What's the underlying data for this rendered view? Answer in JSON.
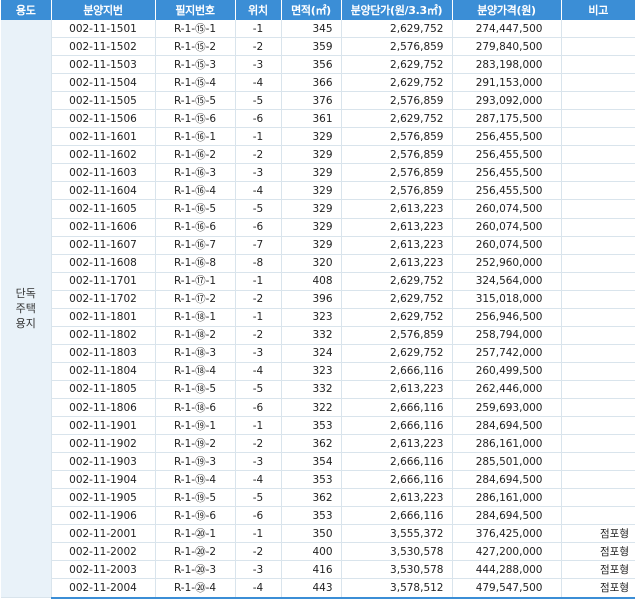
{
  "headers": [
    "용도",
    "분양지번",
    "필지번호",
    "위치",
    "면적(㎡)",
    "분양단가(원/3.3㎡)",
    "분양가격(원)",
    "비고"
  ],
  "usage_lines": [
    "단독",
    "주택",
    "용지"
  ],
  "rows": [
    {
      "lot": "002-11-1501",
      "parcel": "R-1-⑮-1",
      "pos": "-1",
      "area": "345",
      "unit": "2,629,752",
      "price": "274,447,500",
      "note": ""
    },
    {
      "lot": "002-11-1502",
      "parcel": "R-1-⑮-2",
      "pos": "-2",
      "area": "359",
      "unit": "2,576,859",
      "price": "279,840,500",
      "note": ""
    },
    {
      "lot": "002-11-1503",
      "parcel": "R-1-⑮-3",
      "pos": "-3",
      "area": "356",
      "unit": "2,629,752",
      "price": "283,198,000",
      "note": ""
    },
    {
      "lot": "002-11-1504",
      "parcel": "R-1-⑮-4",
      "pos": "-4",
      "area": "366",
      "unit": "2,629,752",
      "price": "291,153,000",
      "note": ""
    },
    {
      "lot": "002-11-1505",
      "parcel": "R-1-⑮-5",
      "pos": "-5",
      "area": "376",
      "unit": "2,576,859",
      "price": "293,092,000",
      "note": ""
    },
    {
      "lot": "002-11-1506",
      "parcel": "R-1-⑮-6",
      "pos": "-6",
      "area": "361",
      "unit": "2,629,752",
      "price": "287,175,500",
      "note": ""
    },
    {
      "lot": "002-11-1601",
      "parcel": "R-1-⑯-1",
      "pos": "-1",
      "area": "329",
      "unit": "2,576,859",
      "price": "256,455,500",
      "note": ""
    },
    {
      "lot": "002-11-1602",
      "parcel": "R-1-⑯-2",
      "pos": "-2",
      "area": "329",
      "unit": "2,576,859",
      "price": "256,455,500",
      "note": ""
    },
    {
      "lot": "002-11-1603",
      "parcel": "R-1-⑯-3",
      "pos": "-3",
      "area": "329",
      "unit": "2,576,859",
      "price": "256,455,500",
      "note": ""
    },
    {
      "lot": "002-11-1604",
      "parcel": "R-1-⑯-4",
      "pos": "-4",
      "area": "329",
      "unit": "2,576,859",
      "price": "256,455,500",
      "note": ""
    },
    {
      "lot": "002-11-1605",
      "parcel": "R-1-⑯-5",
      "pos": "-5",
      "area": "329",
      "unit": "2,613,223",
      "price": "260,074,500",
      "note": ""
    },
    {
      "lot": "002-11-1606",
      "parcel": "R-1-⑯-6",
      "pos": "-6",
      "area": "329",
      "unit": "2,613,223",
      "price": "260,074,500",
      "note": ""
    },
    {
      "lot": "002-11-1607",
      "parcel": "R-1-⑯-7",
      "pos": "-7",
      "area": "329",
      "unit": "2,613,223",
      "price": "260,074,500",
      "note": ""
    },
    {
      "lot": "002-11-1608",
      "parcel": "R-1-⑯-8",
      "pos": "-8",
      "area": "320",
      "unit": "2,613,223",
      "price": "252,960,000",
      "note": ""
    },
    {
      "lot": "002-11-1701",
      "parcel": "R-1-⑰-1",
      "pos": "-1",
      "area": "408",
      "unit": "2,629,752",
      "price": "324,564,000",
      "note": ""
    },
    {
      "lot": "002-11-1702",
      "parcel": "R-1-⑰-2",
      "pos": "-2",
      "area": "396",
      "unit": "2,629,752",
      "price": "315,018,000",
      "note": ""
    },
    {
      "lot": "002-11-1801",
      "parcel": "R-1-⑱-1",
      "pos": "-1",
      "area": "323",
      "unit": "2,629,752",
      "price": "256,946,500",
      "note": ""
    },
    {
      "lot": "002-11-1802",
      "parcel": "R-1-⑱-2",
      "pos": "-2",
      "area": "332",
      "unit": "2,576,859",
      "price": "258,794,000",
      "note": ""
    },
    {
      "lot": "002-11-1803",
      "parcel": "R-1-⑱-3",
      "pos": "-3",
      "area": "324",
      "unit": "2,629,752",
      "price": "257,742,000",
      "note": ""
    },
    {
      "lot": "002-11-1804",
      "parcel": "R-1-⑱-4",
      "pos": "-4",
      "area": "323",
      "unit": "2,666,116",
      "price": "260,499,500",
      "note": ""
    },
    {
      "lot": "002-11-1805",
      "parcel": "R-1-⑱-5",
      "pos": "-5",
      "area": "332",
      "unit": "2,613,223",
      "price": "262,446,000",
      "note": ""
    },
    {
      "lot": "002-11-1806",
      "parcel": "R-1-⑱-6",
      "pos": "-6",
      "area": "322",
      "unit": "2,666,116",
      "price": "259,693,000",
      "note": ""
    },
    {
      "lot": "002-11-1901",
      "parcel": "R-1-⑲-1",
      "pos": "-1",
      "area": "353",
      "unit": "2,666,116",
      "price": "284,694,500",
      "note": ""
    },
    {
      "lot": "002-11-1902",
      "parcel": "R-1-⑲-2",
      "pos": "-2",
      "area": "362",
      "unit": "2,613,223",
      "price": "286,161,000",
      "note": ""
    },
    {
      "lot": "002-11-1903",
      "parcel": "R-1-⑲-3",
      "pos": "-3",
      "area": "354",
      "unit": "2,666,116",
      "price": "285,501,000",
      "note": ""
    },
    {
      "lot": "002-11-1904",
      "parcel": "R-1-⑲-4",
      "pos": "-4",
      "area": "353",
      "unit": "2,666,116",
      "price": "284,694,500",
      "note": ""
    },
    {
      "lot": "002-11-1905",
      "parcel": "R-1-⑲-5",
      "pos": "-5",
      "area": "362",
      "unit": "2,613,223",
      "price": "286,161,000",
      "note": ""
    },
    {
      "lot": "002-11-1906",
      "parcel": "R-1-⑲-6",
      "pos": "-6",
      "area": "353",
      "unit": "2,666,116",
      "price": "284,694,500",
      "note": ""
    },
    {
      "lot": "002-11-2001",
      "parcel": "R-1-⑳-1",
      "pos": "-1",
      "area": "350",
      "unit": "3,555,372",
      "price": "376,425,000",
      "note": "점포형"
    },
    {
      "lot": "002-11-2002",
      "parcel": "R-1-⑳-2",
      "pos": "-2",
      "area": "400",
      "unit": "3,530,578",
      "price": "427,200,000",
      "note": "점포형"
    },
    {
      "lot": "002-11-2003",
      "parcel": "R-1-⑳-3",
      "pos": "-3",
      "area": "416",
      "unit": "3,530,578",
      "price": "444,288,000",
      "note": "점포형"
    },
    {
      "lot": "002-11-2004",
      "parcel": "R-1-⑳-4",
      "pos": "-4",
      "area": "443",
      "unit": "3,578,512",
      "price": "479,547,500",
      "note": "점포형"
    }
  ],
  "colors": {
    "header_bg": "#3b8ed6",
    "usage_bg": "#e9f2f9",
    "grid": "#d9e4ec"
  }
}
